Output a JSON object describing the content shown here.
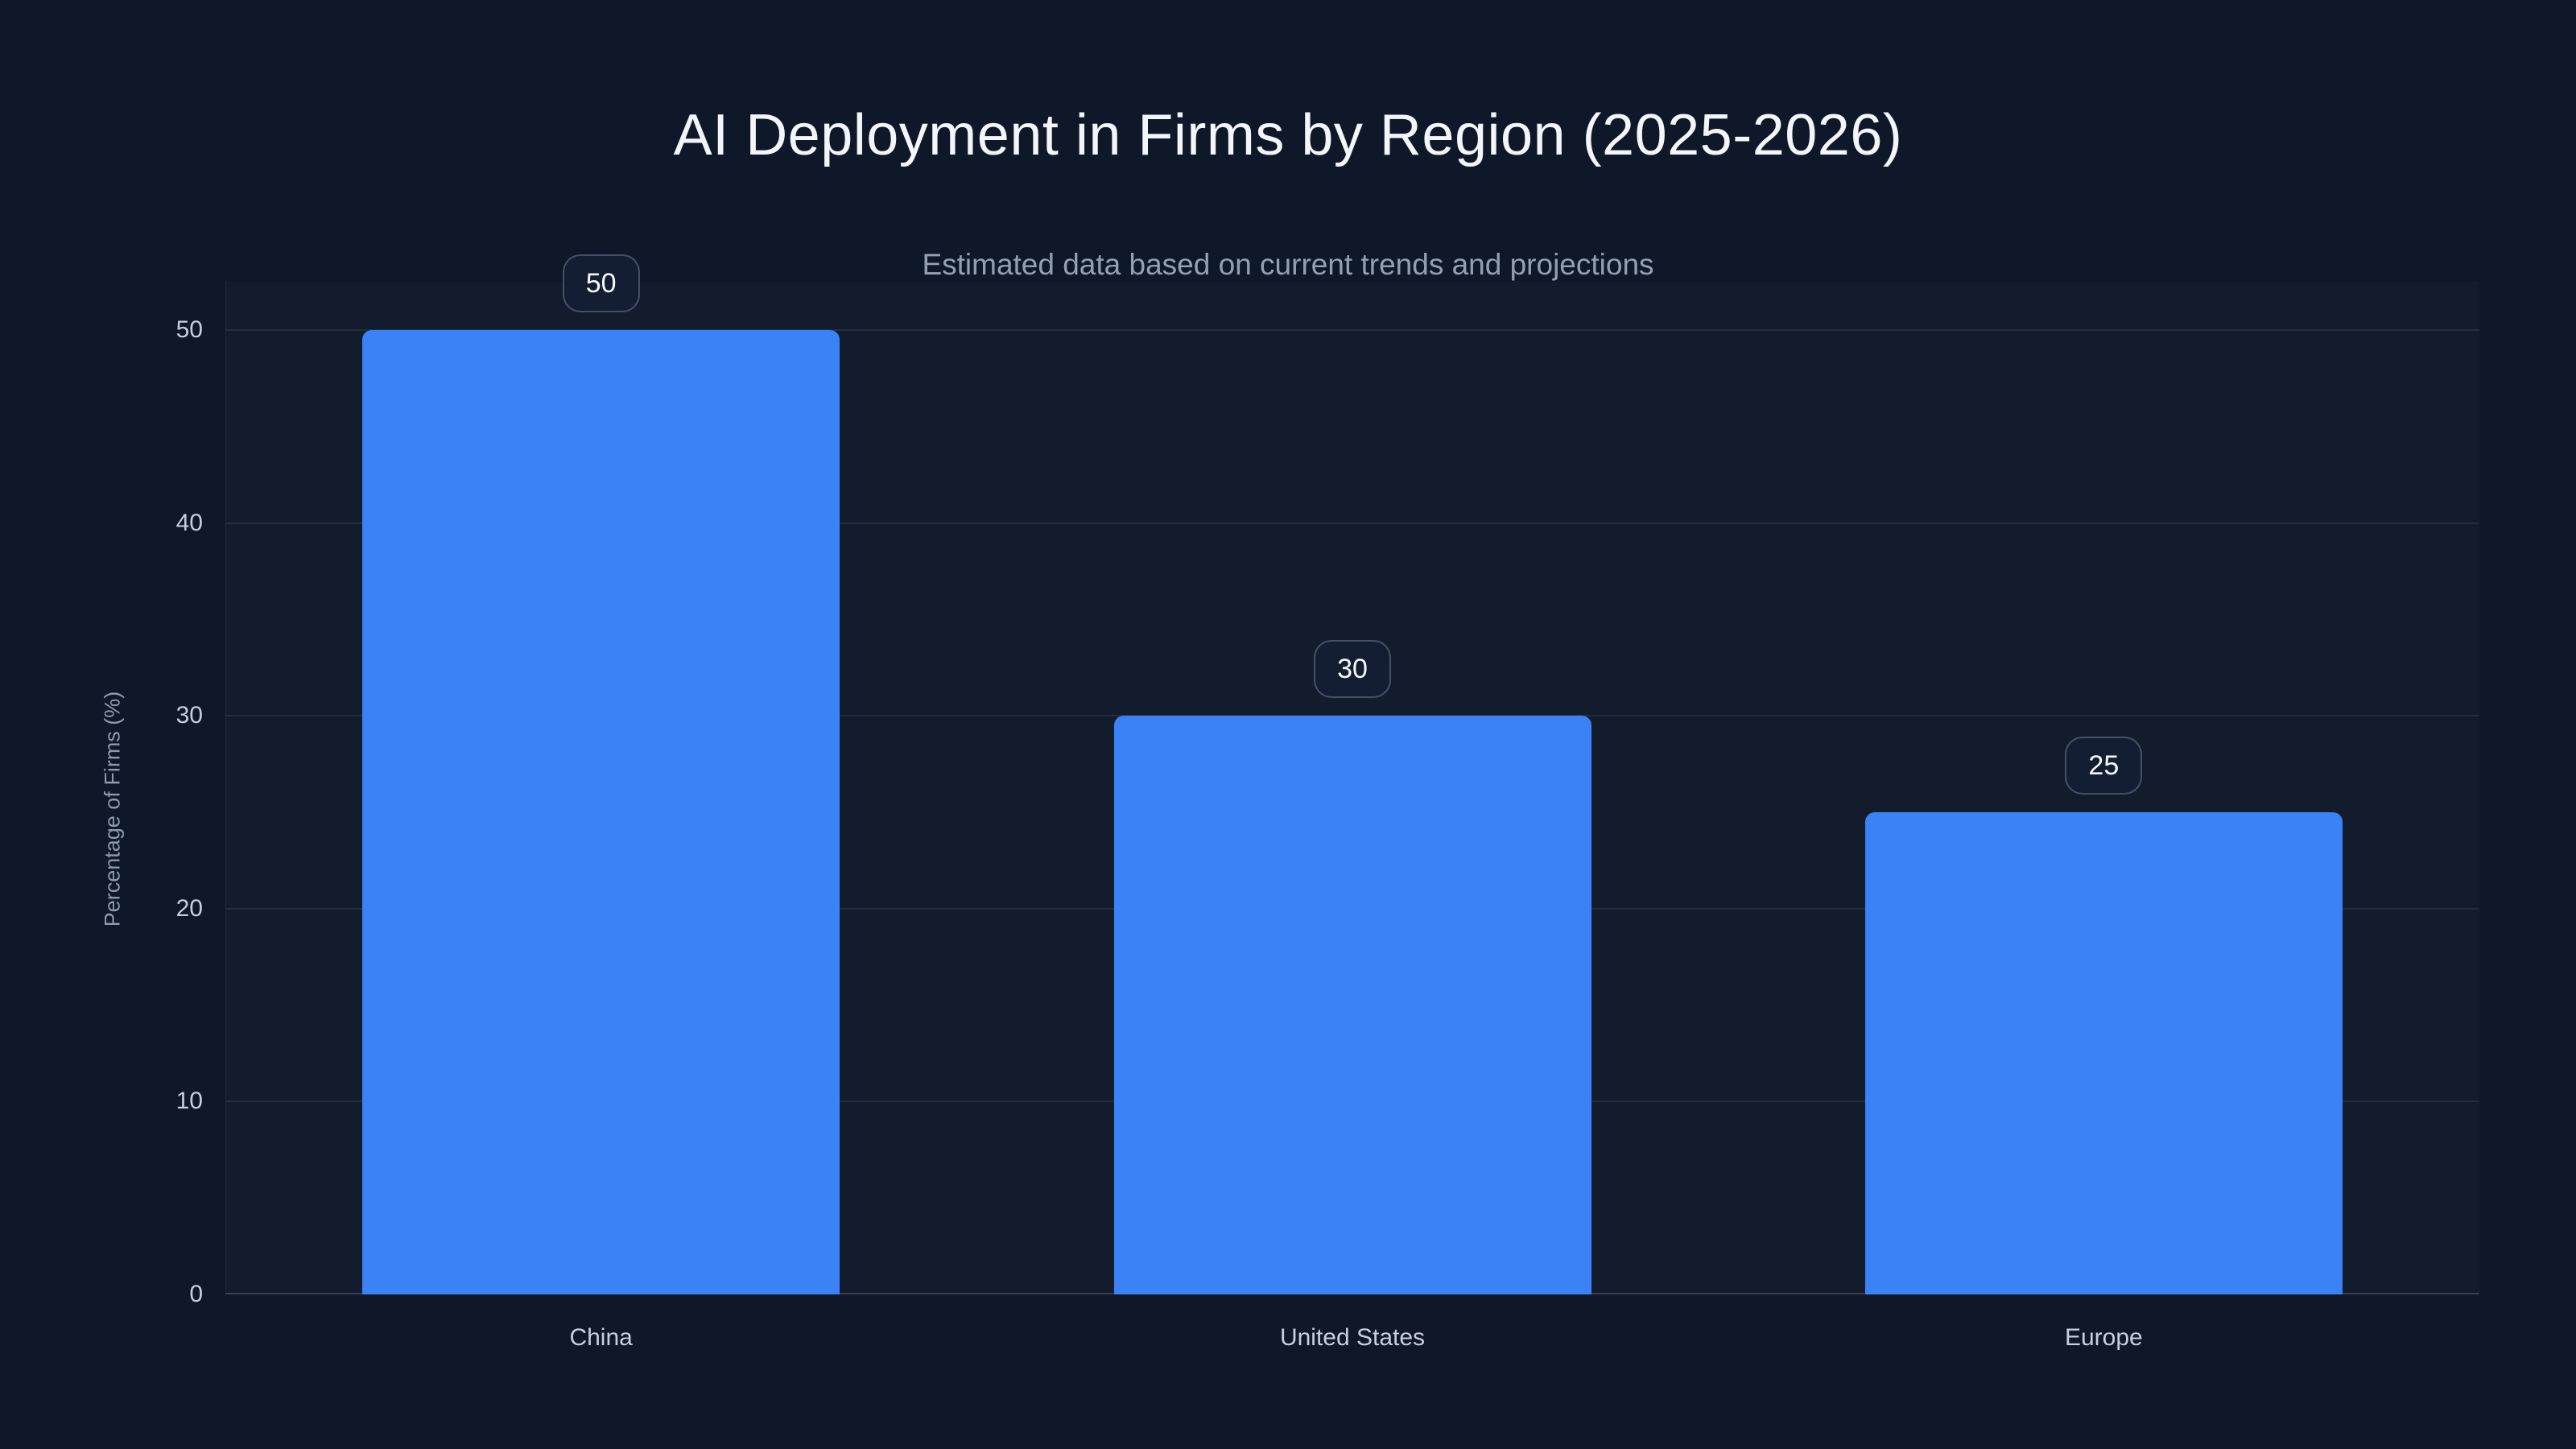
{
  "header": {
    "title": "AI Deployment in Firms by Region (2025-2026)",
    "subtitle": "Estimated data based on current trends and projections"
  },
  "chart_data": {
    "type": "bar",
    "title": "AI Deployment in Firms by Region (2025-2026)",
    "subtitle": "Estimated data based on current trends and projections",
    "categories": [
      "China",
      "United States",
      "Europe"
    ],
    "values": [
      50,
      30,
      25
    ],
    "value_labels": [
      "50",
      "30",
      "25"
    ],
    "xlabel": "",
    "ylabel": "Percentage of Firms (%)",
    "ylim": [
      0,
      50
    ],
    "yticks": [
      0,
      10,
      20,
      30,
      40,
      50
    ],
    "grid": "horizontal",
    "legend": "none"
  },
  "colors": {
    "background": "#0f1828",
    "bar": "#3b82f6",
    "title_text": "#f2f5f9",
    "subtitle_text": "#93a0b4",
    "tick_text": "#c6d0dc",
    "axis_title_text": "#8d9aae",
    "gridline": "rgba(148,163,184,0.13)",
    "badge_border": "rgba(148,163,184,0.38)",
    "badge_background": "#141e33",
    "badge_text": "#f5f8fb"
  }
}
